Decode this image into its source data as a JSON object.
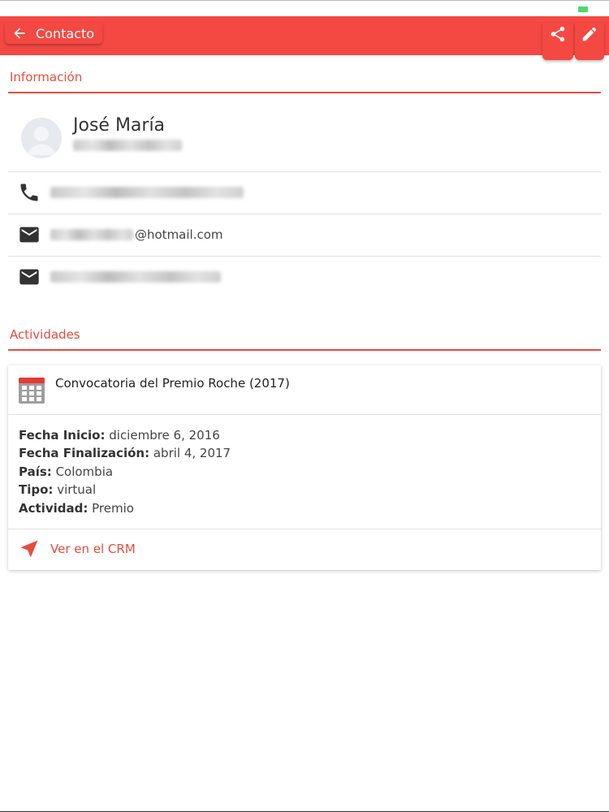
{
  "appbar": {
    "title": "Contacto"
  },
  "sections": {
    "info_title": "Información",
    "activities_title": "Actividades"
  },
  "contact": {
    "name": "José María",
    "email_visible": "@hotmail.com"
  },
  "activity": {
    "title": "Convocatoria del Premio Roche (2017)",
    "details": [
      {
        "label": "Fecha Inicio:",
        "value": "diciembre 6, 2016"
      },
      {
        "label": "Fecha Finalización:",
        "value": "abril 4, 2017"
      },
      {
        "label": "País:",
        "value": "Colombia"
      },
      {
        "label": "Tipo:",
        "value": "virtual"
      },
      {
        "label": "Actividad:",
        "value": "Premio"
      }
    ],
    "crm_link": "Ver en el CRM"
  },
  "colors": {
    "primary": "#f44842",
    "accent_text": "#e74c3c"
  }
}
